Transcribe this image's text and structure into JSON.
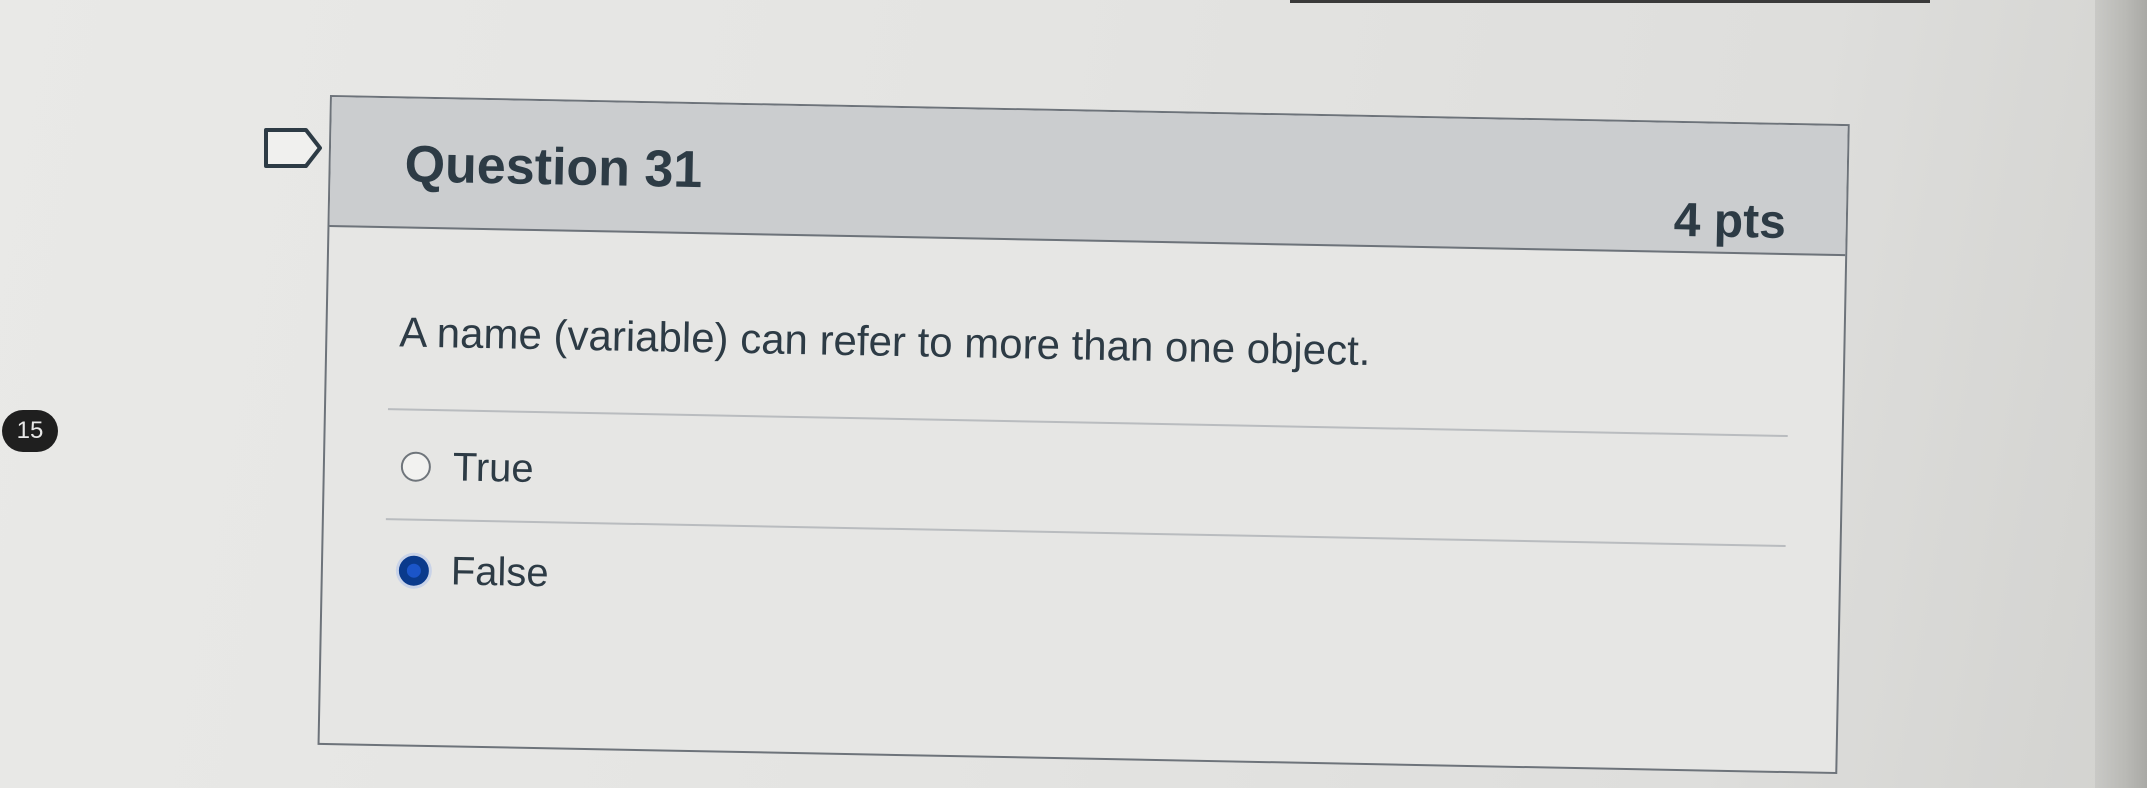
{
  "page_badge": "15",
  "question": {
    "title": "Question 31",
    "points": "4 pts",
    "text": "A name (variable) can refer to more than one object.",
    "answers": [
      {
        "label": "True",
        "selected": false
      },
      {
        "label": "False",
        "selected": true
      }
    ]
  },
  "colors": {
    "header_bg": "#cbcdcf",
    "text": "#2d3b45",
    "selected_radio": "#0a3a8c"
  }
}
